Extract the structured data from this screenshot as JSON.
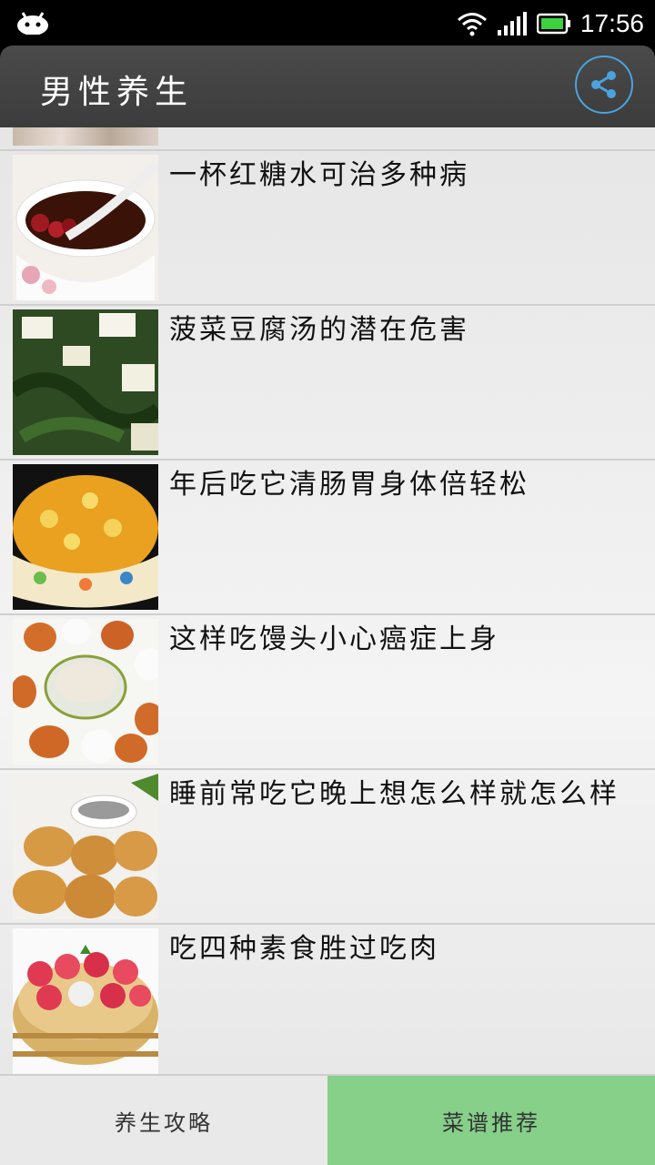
{
  "status_bar": {
    "time": "17:56"
  },
  "app_bar": {
    "title": "男性养生"
  },
  "list": {
    "items": [
      {
        "title": "一杯红糖水可治多种病"
      },
      {
        "title": "菠菜豆腐汤的潜在危害"
      },
      {
        "title": "年后吃它清肠胃身体倍轻松"
      },
      {
        "title": "这样吃馒头小心癌症上身"
      },
      {
        "title": "睡前常吃它晚上想怎么样就怎么样"
      },
      {
        "title": "吃四种素食胜过吃肉"
      }
    ]
  },
  "tabs": [
    {
      "label": "养生攻略"
    },
    {
      "label": "菜谱推荐"
    }
  ],
  "colors": {
    "app_bar": "#444444",
    "share_ring": "#4aa3df",
    "active_tab": "#86d08a",
    "inactive_tab": "#e9e9e9"
  }
}
